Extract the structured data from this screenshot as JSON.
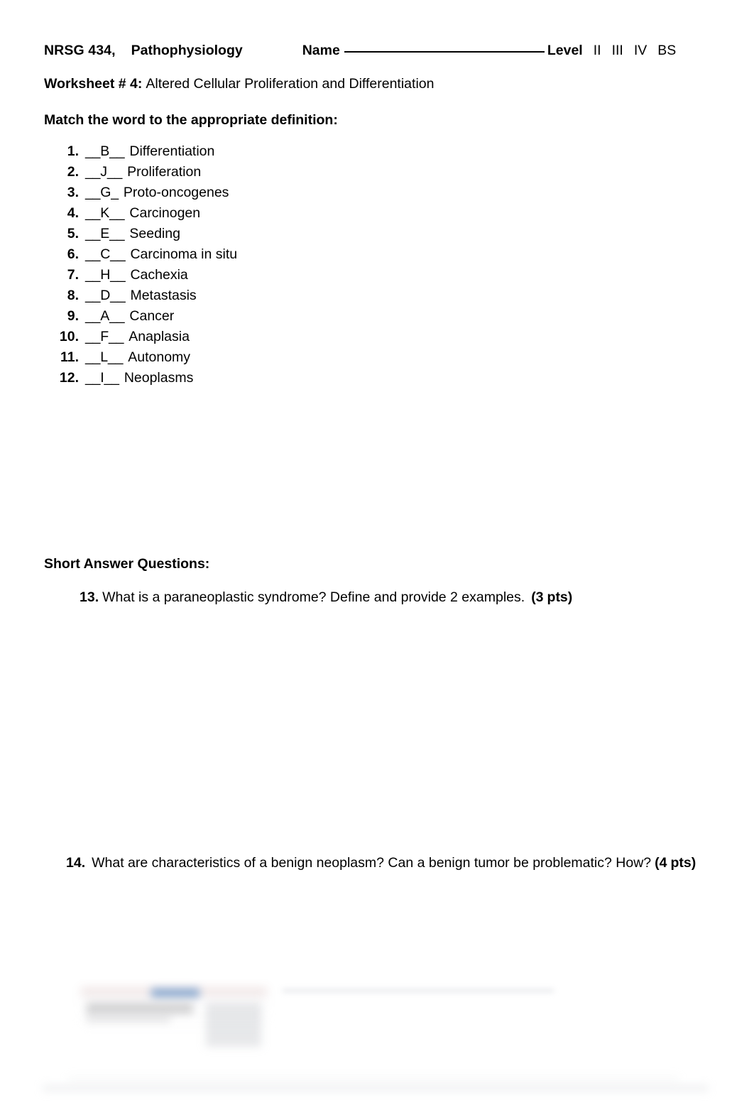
{
  "header": {
    "course_code": "NRSG 434,",
    "course_name": "Pathophysiology",
    "name_label": "Name",
    "name_value": "",
    "level_label": "Level",
    "level_options": [
      "II",
      "III",
      "IV",
      "BS"
    ]
  },
  "worksheet": {
    "label": "Worksheet # 4:",
    "topic": "Altered Cellular Proliferation and Differentiation"
  },
  "matching": {
    "instruction": "Match the word to the appropriate definition:",
    "items": [
      {
        "number": "1.",
        "blank": "__B__",
        "answer": "B",
        "term": "Differentiation"
      },
      {
        "number": "2.",
        "blank": "__J__",
        "answer": "J",
        "term": "Proliferation"
      },
      {
        "number": "3.",
        "blank": "__G_",
        "answer": "G",
        "term": "Proto-oncogenes"
      },
      {
        "number": "4.",
        "blank": "__K__",
        "answer": "K",
        "term": "Carcinogen"
      },
      {
        "number": "5.",
        "blank": "__E__",
        "answer": "E",
        "term": "Seeding"
      },
      {
        "number": "6.",
        "blank": "__C__",
        "answer": "C",
        "term": "Carcinoma in situ"
      },
      {
        "number": "7.",
        "blank": "__H__",
        "answer": "H",
        "term": "Cachexia"
      },
      {
        "number": "8.",
        "blank": "__D__",
        "answer": "D",
        "term": "Metastasis"
      },
      {
        "number": "9.",
        "blank": "__A__",
        "answer": "A",
        "term": "Cancer"
      },
      {
        "number": "10.",
        "blank": "__F__",
        "answer": "F",
        "term": "Anaplasia"
      },
      {
        "number": "11.",
        "blank": "__L__",
        "answer": "L",
        "term": "Autonomy"
      },
      {
        "number": "12.",
        "blank": "__I__",
        "answer": "I",
        "term": "Neoplasms"
      }
    ]
  },
  "short_answer": {
    "heading": "Short Answer Questions:",
    "questions": [
      {
        "number": "13.",
        "text": "What is a paraneoplastic syndrome? Define and provide 2 examples.",
        "points_open": "(3",
        "points_close": "pts)"
      },
      {
        "number": "14.",
        "text": "What are characteristics of a benign neoplasm?  Can a benign tumor be problematic?  How?",
        "points_open": "(4",
        "points_close": "pts)"
      }
    ]
  }
}
